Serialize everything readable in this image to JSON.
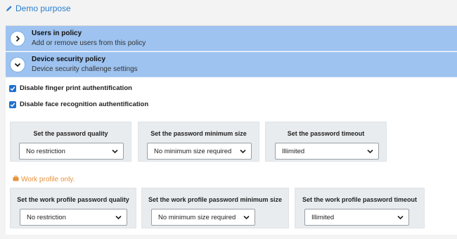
{
  "header": {
    "demo_link": "Demo purpose"
  },
  "accordions": [
    {
      "title": "Users in policy",
      "subtitle": "Add or remove users from this policy"
    },
    {
      "title": "Device security policy",
      "subtitle": "Device security challenge settings"
    }
  ],
  "checkboxes": [
    {
      "label": "Disable finger print authentification",
      "checked": true
    },
    {
      "label": "Disable face recognition authentification",
      "checked": true
    }
  ],
  "password_settings": [
    {
      "label": "Set the password quality",
      "value": "No restriction"
    },
    {
      "label": "Set the password minimum size",
      "value": "No minimum size required"
    },
    {
      "label": "Set the password timeout",
      "value": "Illimited"
    }
  ],
  "work_profile": {
    "note": "Work profile only.",
    "settings": [
      {
        "label": "Set the work profile password quality",
        "value": "No restriction"
      },
      {
        "label": "Set the work profile password minimum size",
        "value": "No minimum size required"
      },
      {
        "label": "Set the work profile password timeout",
        "value": "Illimited"
      }
    ]
  },
  "colors": {
    "accordion_bg": "#9ec3f0",
    "link": "#2a7fcf",
    "checkbox": "#1f6fd1",
    "warning": "#e8913a"
  }
}
